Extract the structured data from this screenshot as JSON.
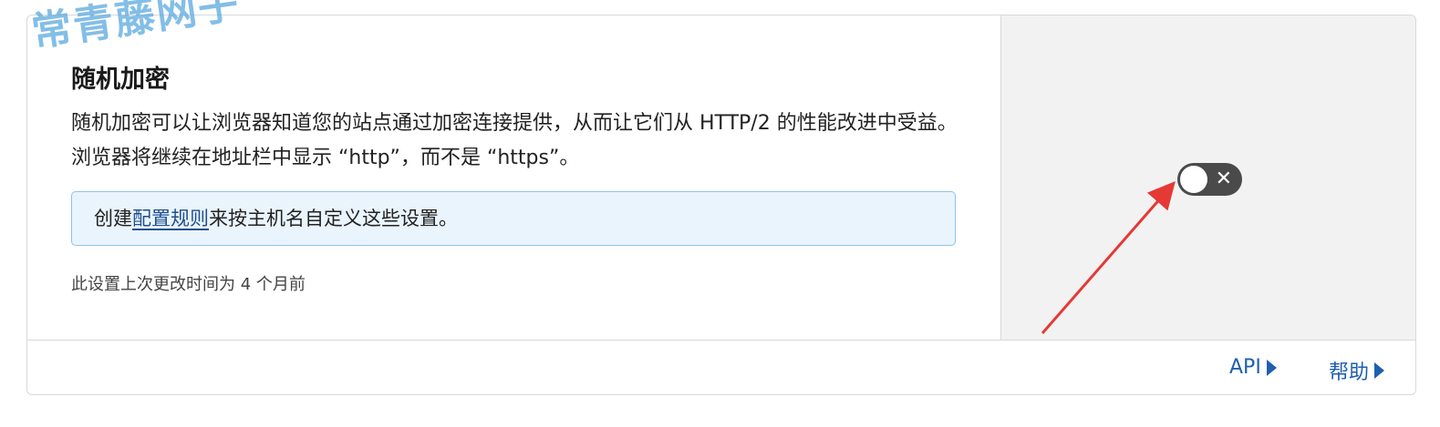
{
  "watermark": "常青藤网子",
  "setting": {
    "title": "随机加密",
    "description": "随机加密可以让浏览器知道您的站点通过加密连接提供，从而让它们从 HTTP/2 的性能改进中受益。浏览器将继续在地址栏中显示 “http”，而不是 “https”。",
    "info_prefix": "创建",
    "info_link": "配置规则",
    "info_suffix": "来按主机名自定义这些设置。",
    "last_modified": "此设置上次更改时间为 4 个月前"
  },
  "toggle": {
    "state_symbol": "✕",
    "enabled": false,
    "track_color": "#4a4a4a"
  },
  "annotation": {
    "arrow_color": "#e53935"
  },
  "footer": {
    "api_label": "API",
    "help_label": "帮助",
    "link_color": "#1f5fb0"
  }
}
